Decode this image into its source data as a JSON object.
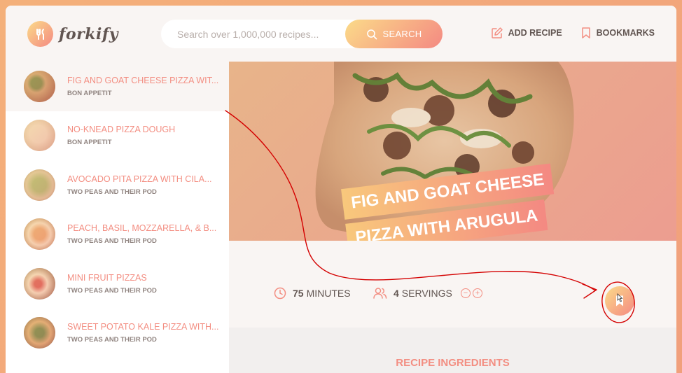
{
  "header": {
    "logo_text": "forkify",
    "search_placeholder": "Search over 1,000,000 recipes...",
    "search_button": "SEARCH",
    "nav": [
      {
        "label": "ADD RECIPE",
        "icon": "edit-icon"
      },
      {
        "label": "BOOKMARKS",
        "icon": "bookmark-icon"
      }
    ]
  },
  "results": [
    {
      "title": "FIG AND GOAT CHEESE PIZZA WIT...",
      "publisher": "BON APPETIT",
      "active": true
    },
    {
      "title": "NO-KNEAD PIZZA DOUGH",
      "publisher": "BON APPETIT"
    },
    {
      "title": "AVOCADO PITA PIZZA WITH CILA...",
      "publisher": "TWO PEAS AND THEIR POD"
    },
    {
      "title": "PEACH, BASIL, MOZZARELLA, & B...",
      "publisher": "TWO PEAS AND THEIR POD"
    },
    {
      "title": "MINI FRUIT PIZZAS",
      "publisher": "TWO PEAS AND THEIR POD"
    },
    {
      "title": "SWEET POTATO KALE PIZZA WITH...",
      "publisher": "TWO PEAS AND THEIR POD"
    }
  ],
  "recipe": {
    "title_line1": "FIG AND GOAT CHEESE",
    "title_line2": "PIZZA WITH ARUGULA",
    "minutes_value": "75",
    "minutes_label": "MINUTES",
    "servings_value": "4",
    "servings_label": "SERVINGS",
    "ingredients_title": "RECIPE INGREDIENTS"
  },
  "colors": {
    "accent_start": "#fbdb89",
    "accent_end": "#f48982",
    "text": "#615551",
    "annotation": "#d40000"
  }
}
